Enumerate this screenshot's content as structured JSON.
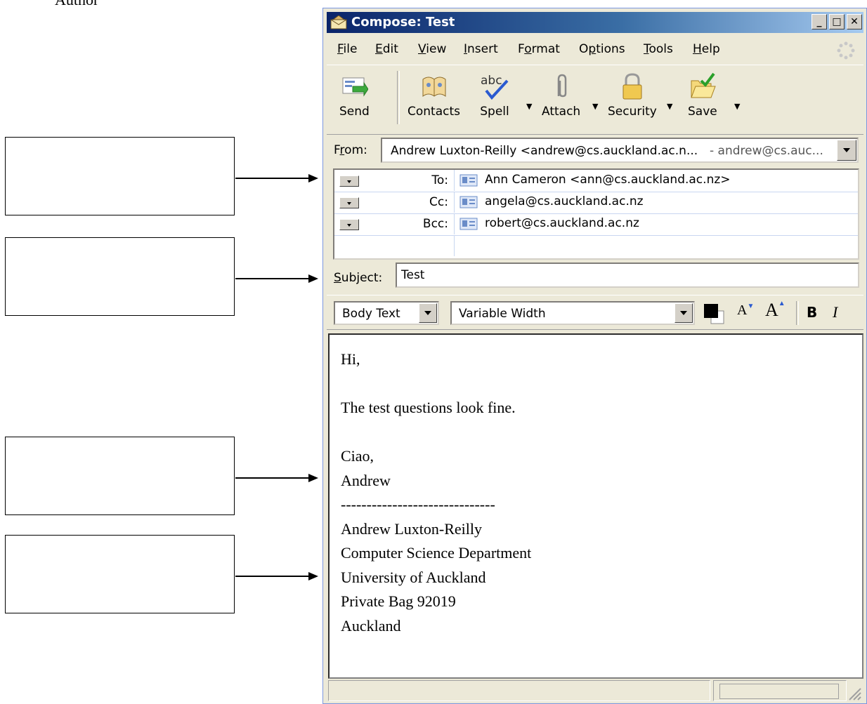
{
  "caption": "Author",
  "window": {
    "title": "Compose: Test",
    "controls": [
      "_",
      "□",
      "✕"
    ]
  },
  "menu": [
    {
      "label": "File",
      "accel": "F"
    },
    {
      "label": "Edit",
      "accel": "E"
    },
    {
      "label": "View",
      "accel": "V"
    },
    {
      "label": "Insert",
      "accel": "I"
    },
    {
      "label": "Format",
      "accel": "o"
    },
    {
      "label": "Options",
      "accel": "p"
    },
    {
      "label": "Tools",
      "accel": "T"
    },
    {
      "label": "Help",
      "accel": "H"
    }
  ],
  "toolbar": {
    "send": "Send",
    "contacts": "Contacts",
    "spell": "Spell",
    "attach": "Attach",
    "security": "Security",
    "save": "Save"
  },
  "from": {
    "label": "From:",
    "value": "Andrew Luxton-Reilly <andrew@cs.auckland.ac.n...",
    "account": "- andrew@cs.auc..."
  },
  "recipients": [
    {
      "type": "To:",
      "address": "Ann Cameron <ann@cs.auckland.ac.nz>"
    },
    {
      "type": "Cc:",
      "address": "angela@cs.auckland.ac.nz"
    },
    {
      "type": "Bcc:",
      "address": "robert@cs.auckland.ac.nz"
    }
  ],
  "subject": {
    "label": "Subject:",
    "value": "Test"
  },
  "format": {
    "paragraph_style": "Body Text",
    "font": "Variable Width",
    "bold": "B",
    "italic": "I"
  },
  "body": [
    "Hi,",
    "",
    "The test questions look fine.",
    "",
    "Ciao,",
    "Andrew",
    "------------------------------",
    "Andrew Luxton-Reilly",
    "Computer Science Department",
    "University of Auckland",
    "Private Bag 92019",
    "Auckland"
  ],
  "colors": {
    "titlebar_start": "#0a246a",
    "titlebar_end": "#a6caf0",
    "window_face": "#ece9d8"
  }
}
